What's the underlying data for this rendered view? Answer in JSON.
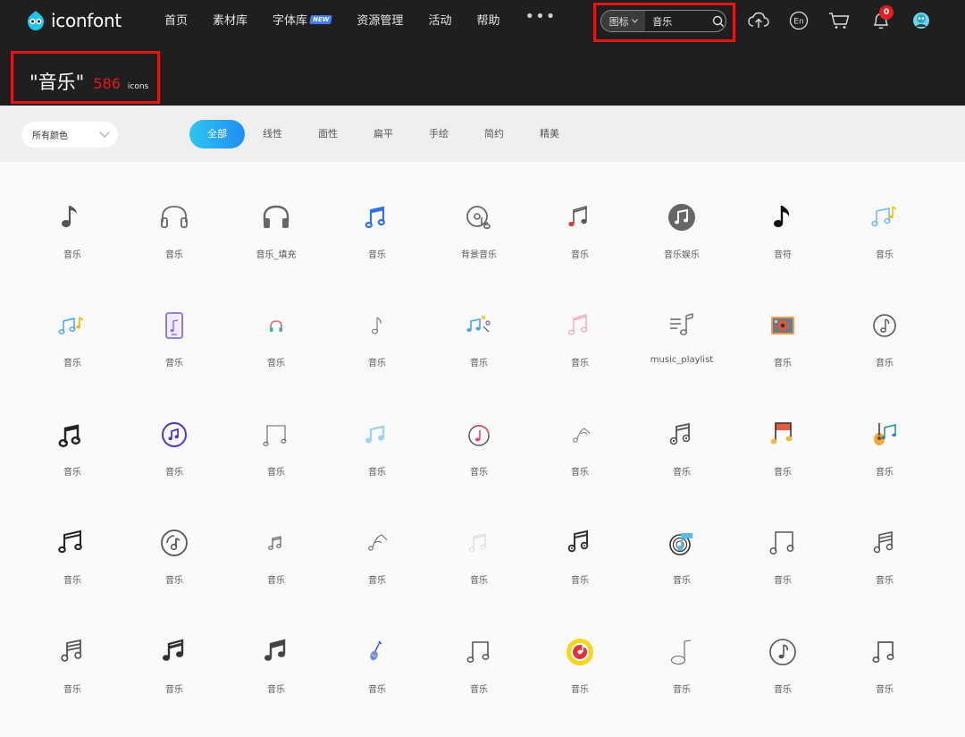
{
  "header": {
    "logo_text": "iconfont",
    "nav": [
      {
        "label": "首页"
      },
      {
        "label": "素材库"
      },
      {
        "label": "字体库",
        "badge": "NEW"
      },
      {
        "label": "资源管理"
      },
      {
        "label": "活动"
      },
      {
        "label": "帮助"
      }
    ],
    "nav_more": "•••",
    "search": {
      "type": "图标",
      "value": "音乐"
    },
    "notifications_count": "0"
  },
  "title": {
    "query": "\"音乐\"",
    "count": "586",
    "unit": "icons"
  },
  "filters": {
    "color_select": "所有颜色",
    "styles": [
      "全部",
      "线性",
      "面性",
      "扁平",
      "手绘",
      "简约",
      "精美"
    ],
    "active_style": "全部"
  },
  "icons": [
    [
      {
        "label": "音乐",
        "icon": "music-note-icon"
      },
      {
        "label": "音乐",
        "icon": "headphones-outline-icon"
      },
      {
        "label": "音乐_填充",
        "icon": "headphones-filled-icon"
      },
      {
        "label": "音乐",
        "icon": "double-note-blue-icon"
      },
      {
        "label": "背景音乐",
        "icon": "disc-note-icon"
      },
      {
        "label": "音乐",
        "icon": "double-note-red-icon"
      },
      {
        "label": "音乐娱乐",
        "icon": "music-circle-icon"
      },
      {
        "label": "音符",
        "icon": "eighth-note-icon"
      },
      {
        "label": "音乐",
        "icon": "double-note-color-icon"
      }
    ],
    [
      {
        "label": "音乐",
        "icon": "notes-colorful-icon"
      },
      {
        "label": "音乐",
        "icon": "music-phone-icon"
      },
      {
        "label": "音乐",
        "icon": "headset-small-icon"
      },
      {
        "label": "音乐",
        "icon": "note-thin-icon"
      },
      {
        "label": "音乐",
        "icon": "notes-sparkle-icon"
      },
      {
        "label": "音乐",
        "icon": "double-note-pink-icon"
      },
      {
        "label": "music_playlist",
        "icon": "playlist-icon"
      },
      {
        "label": "音乐",
        "icon": "cassette-icon"
      },
      {
        "label": "音乐",
        "icon": "note-circle-icon"
      }
    ],
    [
      {
        "label": "音乐",
        "icon": "double-note-bold-icon"
      },
      {
        "label": "音乐",
        "icon": "music-circle-purple-icon"
      },
      {
        "label": "音乐",
        "icon": "double-note-thin-icon"
      },
      {
        "label": "音乐",
        "icon": "double-note-lightblue-icon"
      },
      {
        "label": "音乐",
        "icon": "note-circle-red-icon"
      },
      {
        "label": "音乐",
        "icon": "sketch-note-icon"
      },
      {
        "label": "音乐",
        "icon": "double-note-dark-icon"
      },
      {
        "label": "音乐",
        "icon": "double-note-orange-icon"
      },
      {
        "label": "音乐",
        "icon": "guitar-note-icon"
      }
    ],
    [
      {
        "label": "音乐",
        "icon": "double-note-black-icon"
      },
      {
        "label": "音乐",
        "icon": "vinyl-note-icon"
      },
      {
        "label": "音乐",
        "icon": "double-note-small-icon"
      },
      {
        "label": "音乐",
        "icon": "sketch-note-2-icon"
      },
      {
        "label": "音乐",
        "icon": "double-note-faint-icon"
      },
      {
        "label": "音乐",
        "icon": "double-note-solid-icon"
      },
      {
        "label": "音乐",
        "icon": "record-note-icon"
      },
      {
        "label": "音乐",
        "icon": "double-note-outline-icon"
      },
      {
        "label": "音乐",
        "icon": "double-note-grey-icon"
      }
    ],
    [
      {
        "label": "音乐",
        "icon": "double-note-grey2-icon"
      },
      {
        "label": "音乐",
        "icon": "double-note-heavy-icon"
      },
      {
        "label": "音乐",
        "icon": "double-note-heavy2-icon"
      },
      {
        "label": "音乐",
        "icon": "violin-icon"
      },
      {
        "label": "音乐",
        "icon": "double-note-line-icon"
      },
      {
        "label": "音乐",
        "icon": "record-yellow-icon"
      },
      {
        "label": "音乐",
        "icon": "single-note-line-icon"
      },
      {
        "label": "音乐",
        "icon": "note-circle-outline-icon"
      },
      {
        "label": "音乐",
        "icon": "double-note-line2-icon"
      }
    ]
  ]
}
